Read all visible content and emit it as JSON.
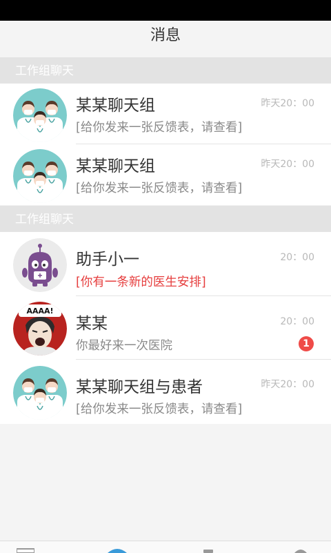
{
  "header": {
    "title": "消息"
  },
  "sections": [
    {
      "title": "工作组聊天",
      "conversations": [
        {
          "name": "某某聊天组",
          "time": "昨天20：00",
          "message": "[给你发来一张反馈表，请查看]",
          "avatar": "doctors-group-avatar"
        },
        {
          "name": "某某聊天组",
          "time": "昨天20：00",
          "message": "[给你发来一张反馈表，请查看]",
          "avatar": "doctors-group-avatar"
        }
      ]
    },
    {
      "title": "工作组聊天",
      "conversations": [
        {
          "name": "助手小一",
          "time": "20：00",
          "message": "[你有一条新的医生安排]",
          "highlight_color": "#e63e3e",
          "avatar": "robot-assistant-avatar"
        },
        {
          "name": "某某",
          "time": "20：00",
          "message": "你最好来一次医院",
          "unread": "1",
          "avatar_caption": "AAAA!",
          "avatar": "screaming-man-avatar"
        },
        {
          "name": "某某聊天组与患者",
          "time": "昨天20：00",
          "message": "[给你发来一张反馈表，请查看]",
          "avatar": "doctors-group-avatar"
        }
      ]
    }
  ],
  "tab_bar": {
    "icons": [
      "messages-tab-icon",
      "home-tab-icon",
      "contacts-tab-icon",
      "profile-tab-icon"
    ]
  },
  "colors": {
    "accent_red": "#e63e3e",
    "badge_red": "#ef4b48",
    "section_bg": "#e3e3e3",
    "avatar_teal": "#7ccccb"
  }
}
